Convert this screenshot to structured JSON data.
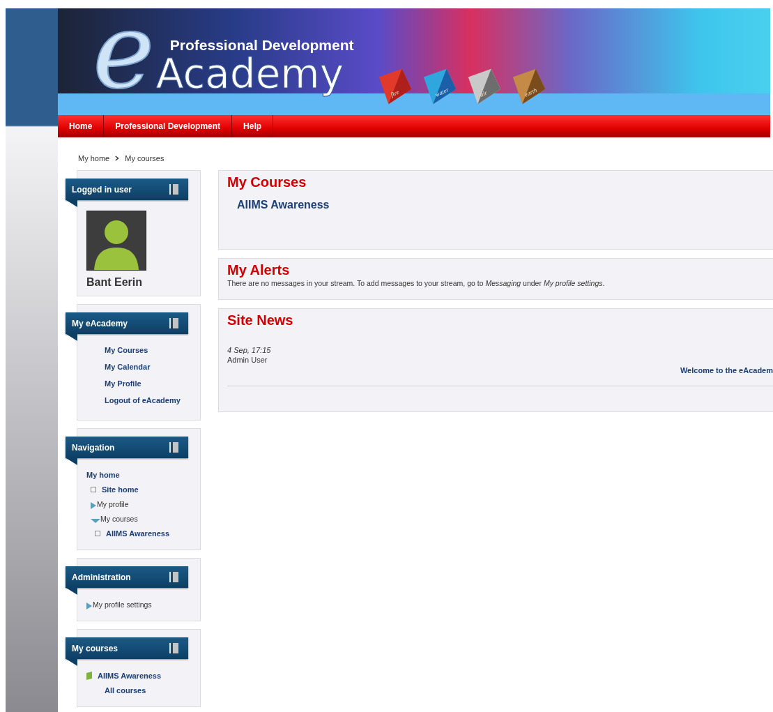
{
  "banner": {
    "subtitle": "Professional Development",
    "logo_letter": "e",
    "logo_word": "Academy",
    "elements": [
      "fire",
      "water",
      "air",
      "earth"
    ]
  },
  "nav_menu": [
    {
      "label": "Home"
    },
    {
      "label": "Professional Development"
    },
    {
      "label": "Help"
    }
  ],
  "breadcrumb": [
    "My home",
    "My courses"
  ],
  "sidebar": [
    {
      "kind": "user",
      "title": "Logged in user",
      "user_name": "Bant Eerin"
    },
    {
      "kind": "links",
      "title": "My eAcademy",
      "items": [
        "My Courses",
        "My Calendar",
        "My Profile",
        "Logout of eAcademy"
      ]
    },
    {
      "kind": "tree",
      "title": "Navigation",
      "items": [
        {
          "kind": "root",
          "label": "My home",
          "children": [
            {
              "kind": "leaf",
              "label": "Site home"
            },
            {
              "kind": "branch",
              "label": "My profile",
              "expanded": false
            },
            {
              "kind": "branch",
              "label": "My courses",
              "expanded": true,
              "children": [
                {
                  "kind": "leaf",
                  "label": "AIIMS Awareness"
                }
              ]
            }
          ]
        }
      ]
    },
    {
      "kind": "tree",
      "title": "Administration",
      "items": [
        {
          "kind": "branch",
          "label": "My profile settings",
          "expanded": false
        }
      ]
    },
    {
      "kind": "tree",
      "title": "My courses",
      "items": [
        {
          "kind": "course",
          "label": "AIIMS Awareness",
          "children": [
            {
              "kind": "plain",
              "label": "All courses"
            }
          ]
        }
      ]
    }
  ],
  "main": [
    {
      "kind": "courses",
      "title": "My Courses",
      "courses": [
        "AIIMS Awareness"
      ]
    },
    {
      "kind": "alerts",
      "title": "My Alerts",
      "text": "There are no messages in your stream. To add messages to your stream, go to *Messaging* under *My profile settings*."
    },
    {
      "kind": "news",
      "title": "Site News",
      "date": "4 Sep, 17:15",
      "author": "Admin User",
      "link": "Welcome to the eAcadem"
    }
  ]
}
